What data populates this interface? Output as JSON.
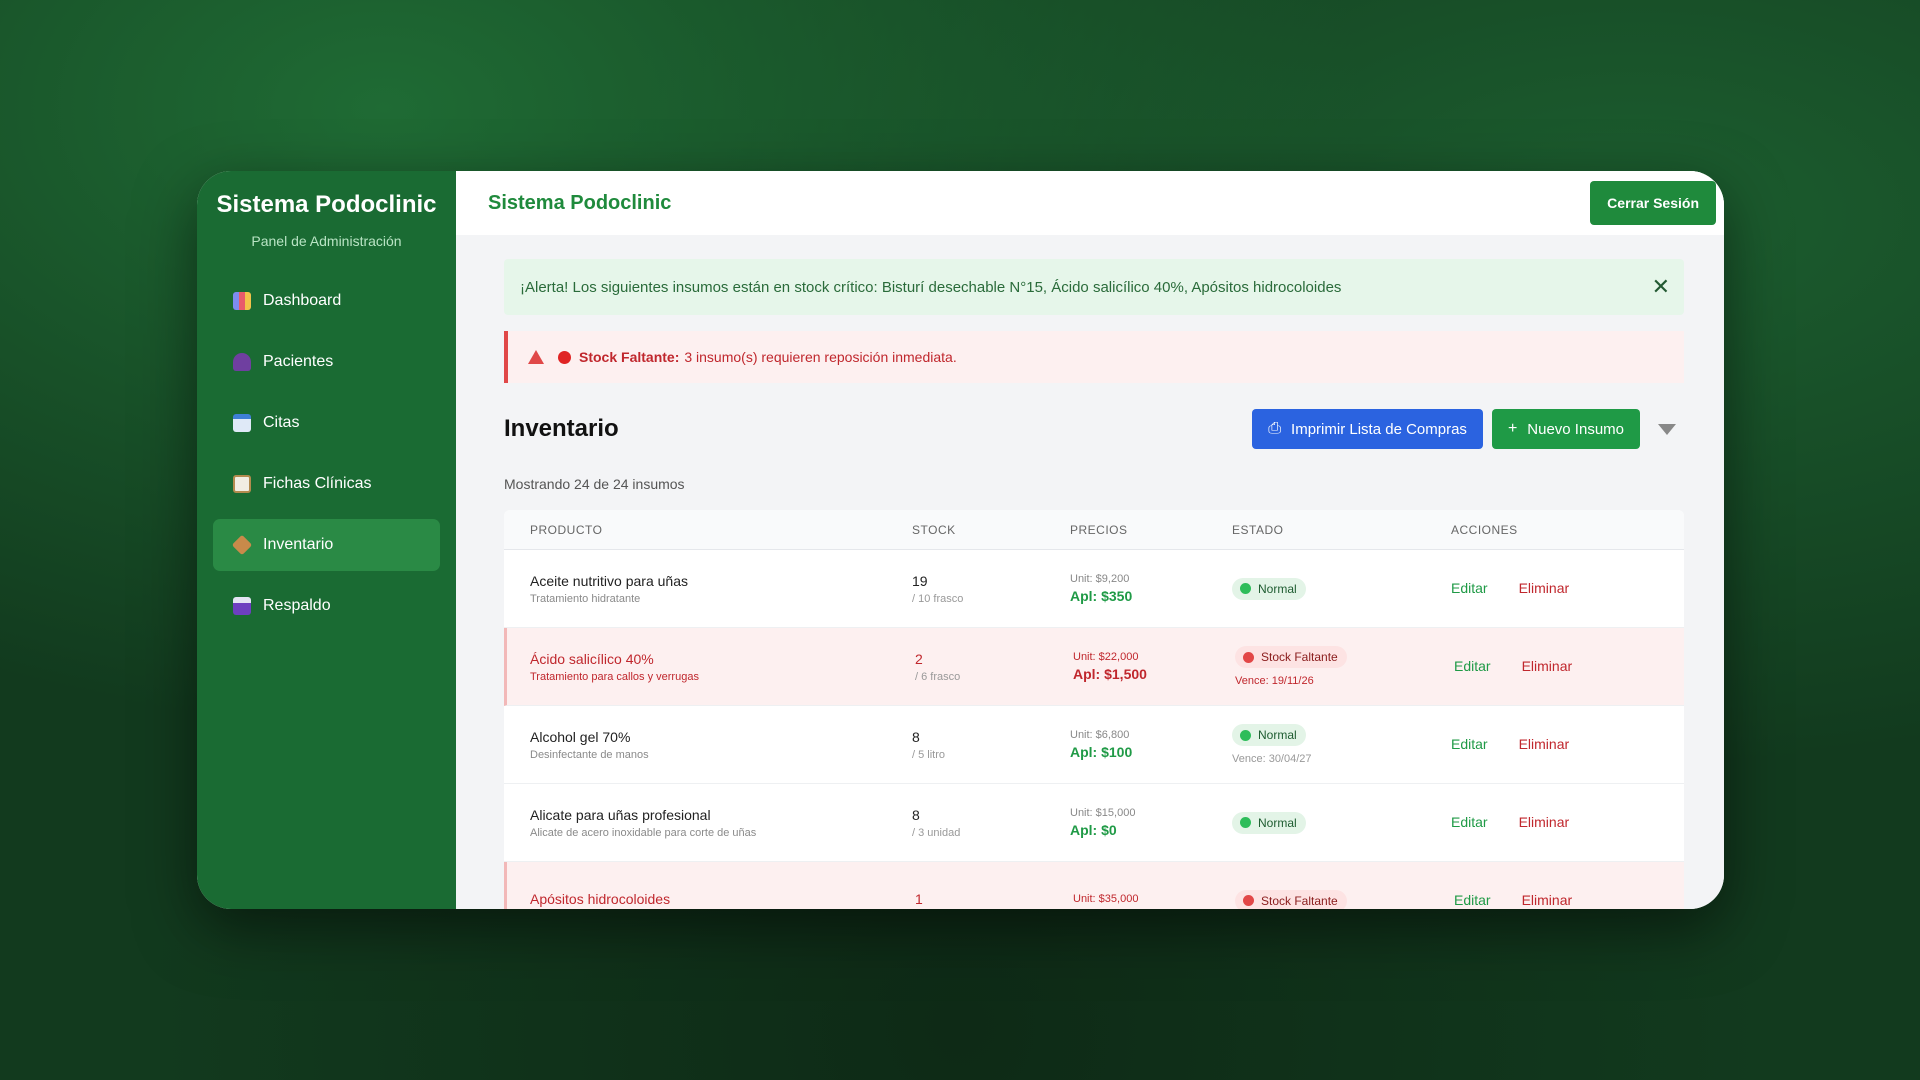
{
  "sidebar": {
    "title": "Sistema Podoclinic",
    "subtitle": "Panel de Administración",
    "items": [
      {
        "label": "Dashboard",
        "icon": "chart-icon"
      },
      {
        "label": "Pacientes",
        "icon": "users-icon"
      },
      {
        "label": "Citas",
        "icon": "calendar-icon"
      },
      {
        "label": "Fichas Clínicas",
        "icon": "clipboard-icon"
      },
      {
        "label": "Inventario",
        "icon": "box-icon",
        "active": true
      },
      {
        "label": "Respaldo",
        "icon": "save-icon"
      }
    ]
  },
  "header": {
    "title": "Sistema Podoclinic",
    "logout_label": "Cerrar Sesión"
  },
  "alert_green": {
    "text": "¡Alerta! Los siguientes insumos están en stock crítico: Bisturí desechable N°15, Ácido salicílico 40%, Apósitos hidrocoloides",
    "close": "✕"
  },
  "alert_red": {
    "bold": "Stock Faltante:",
    "text": "3 insumo(s) requieren reposición inmediata."
  },
  "inventory": {
    "title": "Inventario",
    "print_label": "Imprimir Lista de Compras",
    "new_label": "Nuevo Insumo",
    "showing": "Mostrando 24 de 24 insumos"
  },
  "table": {
    "headers": {
      "product": "PRODUCTO",
      "stock": "STOCK",
      "prices": "PRECIOS",
      "state": "ESTADO",
      "actions": "ACCIONES"
    },
    "edit_label": "Editar",
    "delete_label": "Eliminar",
    "rows": [
      {
        "name": "Aceite nutritivo para uñas",
        "desc": "Tratamiento hidratante",
        "stock": "19",
        "unit": "/ 10 frasco",
        "price_unit": "Unit: $9,200",
        "price_apl": "Apl: $350",
        "state": "Normal",
        "expires": ""
      },
      {
        "name": "Ácido salicílico 40%",
        "desc": "Tratamiento para callos y verrugas",
        "stock": "2",
        "unit": "/ 6 frasco",
        "price_unit": "Unit: $22,000",
        "price_apl": "Apl: $1,500",
        "state": "Stock Faltante",
        "expires": "Vence: 19/11/26"
      },
      {
        "name": "Alcohol gel 70%",
        "desc": "Desinfectante de manos",
        "stock": "8",
        "unit": "/ 5 litro",
        "price_unit": "Unit: $6,800",
        "price_apl": "Apl: $100",
        "state": "Normal",
        "expires": "Vence: 30/04/27"
      },
      {
        "name": "Alicate para uñas profesional",
        "desc": "Alicate de acero inoxidable para corte de uñas",
        "stock": "8",
        "unit": "/ 3 unidad",
        "price_unit": "Unit: $15,000",
        "price_apl": "Apl: $0",
        "state": "Normal",
        "expires": ""
      },
      {
        "name": "Apósitos hidrocoloides",
        "desc": "",
        "stock": "1",
        "unit": "",
        "price_unit": "Unit: $35,000",
        "price_apl": "",
        "state": "Stock Faltante",
        "expires": ""
      }
    ]
  },
  "colors": {
    "sidebar_bg": "#1a6b33",
    "primary_green": "#1f9a46",
    "danger_red": "#c0272d",
    "primary_blue": "#2b63e0"
  }
}
